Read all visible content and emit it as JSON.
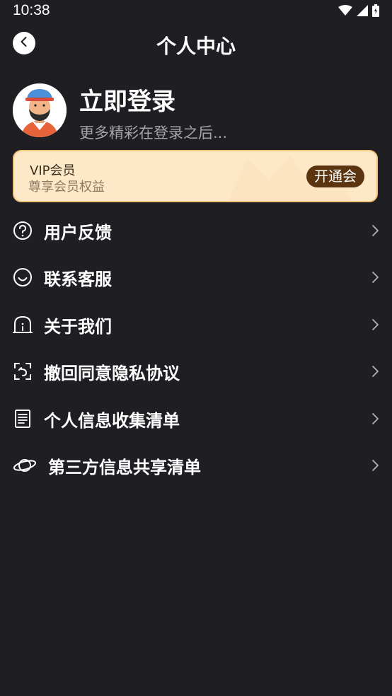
{
  "status_bar": {
    "time": "10:38",
    "icons": [
      "wifi-icon",
      "signal-icon",
      "battery-icon"
    ]
  },
  "header": {
    "title": "个人中心",
    "back_icon": "back-arrow-icon"
  },
  "profile": {
    "title": "立即登录",
    "subtitle": "更多精彩在登录之后..."
  },
  "vip": {
    "title": "VIP会员",
    "subtitle": "尊享会员权益",
    "button_label": "开通会"
  },
  "menu": {
    "items": [
      {
        "label": "用户反馈",
        "icon": "question-icon"
      },
      {
        "label": "联系客服",
        "icon": "smile-icon"
      },
      {
        "label": "关于我们",
        "icon": "info-house-icon"
      },
      {
        "label": "撤回同意隐私协议",
        "icon": "revoke-icon"
      },
      {
        "label": "个人信息收集清单",
        "icon": "document-list-icon"
      },
      {
        "label": "第三方信息共享清单",
        "icon": "planet-icon"
      }
    ]
  },
  "colors": {
    "background": "#1f1e23",
    "vip_background": "#fde8c8",
    "vip_border": "#f2c57f",
    "vip_button": "#5a3510",
    "subtitle_text": "#a3a3a8"
  }
}
